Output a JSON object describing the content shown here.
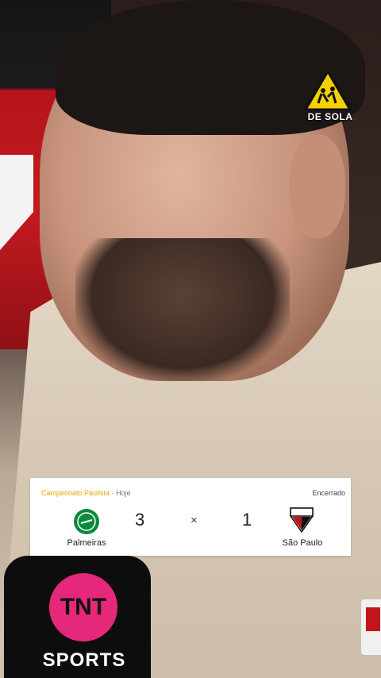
{
  "watermark": {
    "text": "DE SOLA"
  },
  "scorecard": {
    "league": "Campeonato Paulista",
    "separator": " · ",
    "date": "Hoje",
    "status": "Encerrado",
    "home": {
      "name": "Palmeiras",
      "score": "3"
    },
    "away": {
      "name": "São Paulo",
      "score": "1"
    },
    "times_symbol": "×"
  },
  "microphone": {
    "brand": "TNT",
    "subbrand": "SPORTS"
  },
  "colors": {
    "league_accent": "#e0a800",
    "palmeiras_green": "#0a8a3a",
    "spfc_red": "#c3141c",
    "tnt_pink": "#e6287a"
  }
}
